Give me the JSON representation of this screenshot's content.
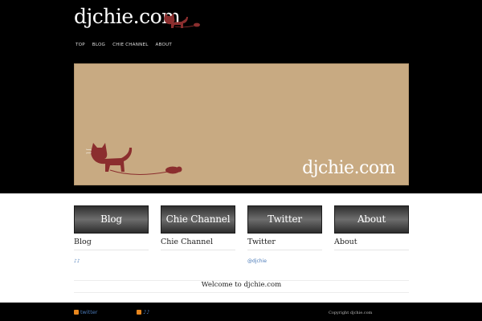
{
  "site": {
    "logo_text": "djchie.com"
  },
  "nav": {
    "items": [
      "TOP",
      "BLOG",
      "CHIE CHANNEL",
      "ABOUT"
    ]
  },
  "hero": {
    "title": "djchie.com"
  },
  "cards": [
    {
      "button": "Blog",
      "title": "Blog",
      "link": "♪♪"
    },
    {
      "button": "Chie Channel",
      "title": "Chie Channel",
      "link": ""
    },
    {
      "button": "Twitter",
      "title": "Twitter",
      "link": "@djchie"
    },
    {
      "button": "About",
      "title": "About",
      "link": ""
    }
  ],
  "welcome": {
    "text": "Welcome to djchie.com"
  },
  "footer": {
    "links": [
      "twitter",
      "♪♪"
    ],
    "copyright": "Copyright djchie.com"
  },
  "colors": {
    "header_bg": "#000000",
    "hero_bg": "#c8aa82",
    "cat": "#8b2e2e",
    "link": "#4a7ab8",
    "rss": "#e8871e"
  },
  "icons": [
    "cat-icon",
    "microphone-icon",
    "rss-icon"
  ]
}
